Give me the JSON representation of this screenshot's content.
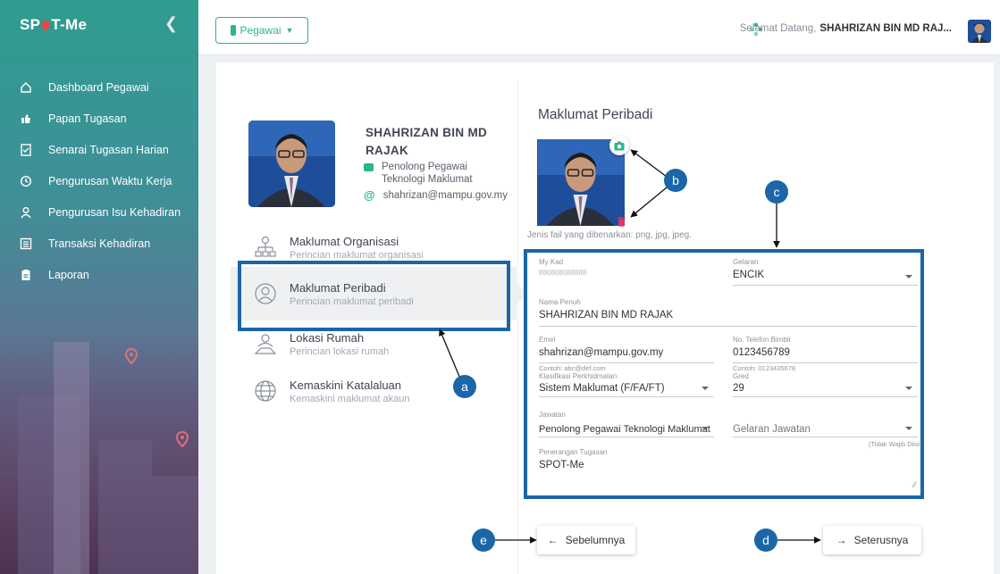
{
  "app": {
    "brand": "SP?T-Me",
    "brand_left": "SP",
    "brand_right": "T-Me"
  },
  "sidebar": {
    "items": [
      {
        "label": "Dashboard Pegawai",
        "icon": "home-icon"
      },
      {
        "label": "Papan Tugasan",
        "icon": "thumbs-up-icon"
      },
      {
        "label": "Senarai Tugasan Harian",
        "icon": "checklist-icon"
      },
      {
        "label": "Pengurusan Waktu Kerja",
        "icon": "clock-history-icon"
      },
      {
        "label": "Pengurusan Isu Kehadiran",
        "icon": "user-icon"
      },
      {
        "label": "Transaksi Kehadiran",
        "icon": "list-icon"
      },
      {
        "label": "Laporan",
        "icon": "report-icon"
      }
    ]
  },
  "topbar": {
    "role_button": "Pegawai",
    "greeting": "Selamat Datang,",
    "username": "SHAHRIZAN BIN MD RAJ..."
  },
  "profile": {
    "name": "SHAHRIZAN BIN MD RAJAK",
    "job": "Penolong Pegawai Teknologi Maklumat",
    "email": "shahrizan@mampu.gov.my"
  },
  "menu": [
    {
      "title": "Maklumat Organisasi",
      "subtitle": "Perincian maklumat organisasi"
    },
    {
      "title": "Maklumat Peribadi",
      "subtitle": "Perincian maklumat peribadi"
    },
    {
      "title": "Lokasi Rumah",
      "subtitle": "Perincian lokasi rumah"
    },
    {
      "title": "Kemaskini Katalaluan",
      "subtitle": "Kemaskini maklumat akaun"
    }
  ],
  "form": {
    "title": "Maklumat Peribadi",
    "file_hint": "Jenis fail yang dibenarkan: png, jpg, jpeg.",
    "mykad_label": "My Kad",
    "mykad_value": "880808088888",
    "gelaran_label": "Gelaran",
    "gelaran_value": "ENCIK",
    "nama_label": "Nama Penuh",
    "nama_value": "SHAHRIZAN BIN MD RAJAK",
    "emel_label": "Emel",
    "emel_value": "shahrizan@mampu.gov.my",
    "emel_hint": "Contoh: abc@def.com",
    "telefon_label": "No. Telefon Bimbit",
    "telefon_value": "0123456789",
    "telefon_hint": "Contoh: 0123435678",
    "klasifikasi_label": "Klasifikasi Perkhidmatan",
    "klasifikasi_value": "Sistem Maklumat (F/FA/FT)",
    "gred_label": "Gred",
    "gred_value": "29",
    "jawatan_label": "Jawatan",
    "jawatan_value": "Penolong Pegawai Teknologi Maklumat",
    "gelaran_jawatan_placeholder": "Gelaran Jawatan",
    "optional_note": "(Tidak Wajib Diisi)",
    "penerangan_label": "Penerangan Tugasan",
    "penerangan_value": "SPOT-Me"
  },
  "buttons": {
    "prev": "Sebelumnya",
    "next": "Seterusnya"
  },
  "callouts": {
    "a": "a",
    "b": "b",
    "c": "c",
    "d": "d",
    "e": "e"
  },
  "colors": {
    "accent": "#2bb58e",
    "annotation": "#1a66a8"
  }
}
